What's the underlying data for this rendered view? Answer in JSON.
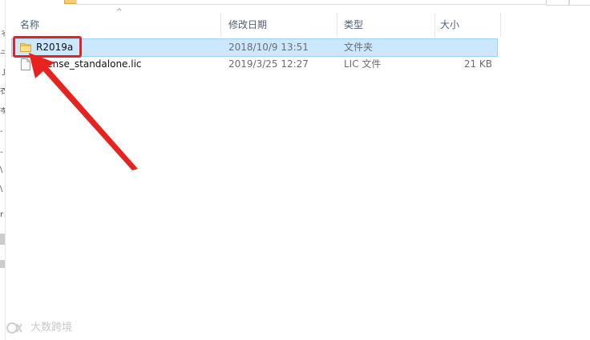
{
  "header": {
    "sort_indicator": "^",
    "columns": {
      "name": "名称",
      "date": "修改日期",
      "type": "类型",
      "size": "大小"
    }
  },
  "files": [
    {
      "name": "R2019a",
      "date": "2018/10/9 13:51",
      "type": "文件夹",
      "size": "",
      "icon": "folder-icon",
      "selected": true
    },
    {
      "name": "license_standalone.lic",
      "date": "2019/3/25 12:27",
      "type": "LIC 文件",
      "size": "21 KB",
      "icon": "file-icon",
      "selected": false
    }
  ],
  "annotation": {
    "highlight_color": "#e02424"
  },
  "watermark": {
    "text": "大数跨境"
  },
  "colors": {
    "selection_bg": "#cce8ff",
    "selection_border": "#99d1ff",
    "folder_yellow": "#f5cf6b",
    "header_text": "#4c607a"
  }
}
